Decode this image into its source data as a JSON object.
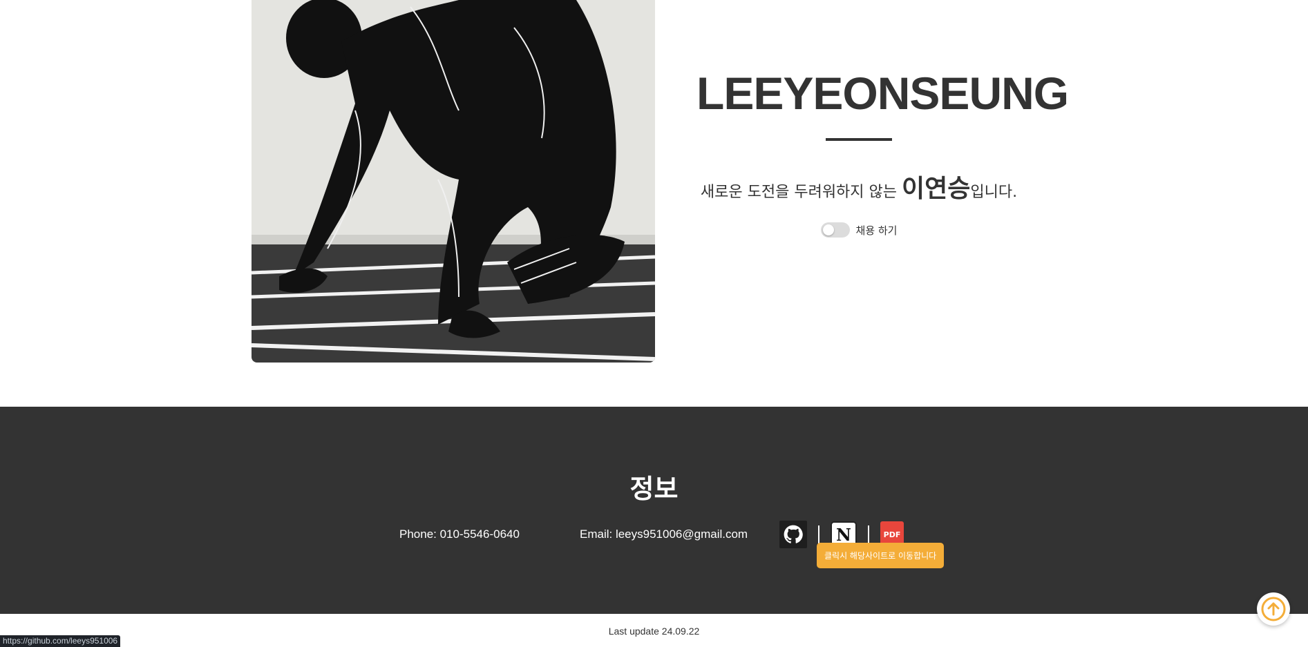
{
  "hero": {
    "image_alt": "sprinter in starting position",
    "name": "LEEYEONSEUNG",
    "tagline_before": "새로운 도전을 두려워하지 않는 ",
    "tagline_highlight": "이연승",
    "tagline_after": "입니다.",
    "toggle_label": "채용 하기",
    "toggle_on": false
  },
  "footer": {
    "title": "정보",
    "phone": "Phone: 010-5546-0640",
    "email": "Email: leeys951006@gmail.com",
    "links": [
      {
        "name": "github",
        "icon": "github-icon"
      },
      {
        "name": "notion",
        "icon": "notion-icon",
        "glyph": "N"
      },
      {
        "name": "pdf",
        "icon": "pdf-icon",
        "label": "PDF"
      }
    ],
    "tooltip": "클릭시 해당사이트로 이동합니다",
    "background": "#333333",
    "accent": "#f4ad38"
  },
  "last_update": "Last update 24.09.22",
  "scroll_top_icon": "arrow-up-circle-icon",
  "status_url": "https://github.com/leeys951006"
}
